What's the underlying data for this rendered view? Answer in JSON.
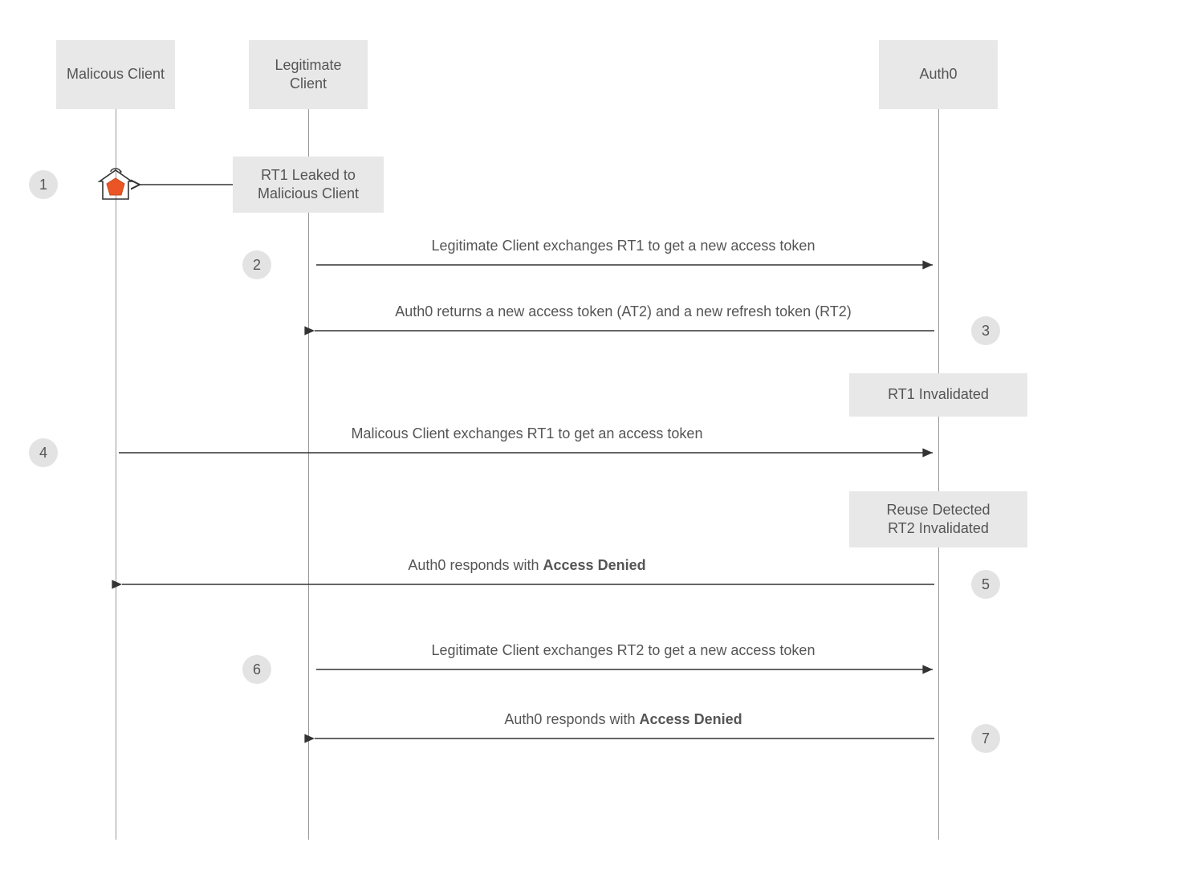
{
  "participants": {
    "malicious": "Malicous Client",
    "legitimate": "Legitimate Client",
    "auth0": "Auth0"
  },
  "notes": {
    "leak": "RT1 Leaked to Malicious Client",
    "rt1_invalidated": "RT1 Invalidated",
    "reuse_line1": "Reuse Detected",
    "reuse_line2": "RT2 Invalidated"
  },
  "messages": {
    "m2": "Legitimate Client exchanges RT1 to get a new access token",
    "m3": "Auth0 returns a new access token (AT2) and a new refresh token (RT2)",
    "m4": "Malicous Client exchanges RT1 to get an access token",
    "m5_pre": "Auth0 responds with ",
    "m5_bold": "Access Denied",
    "m6": "Legitimate Client exchanges RT2 to get a new access token",
    "m7_pre": "Auth0 responds with ",
    "m7_bold": "Access Denied"
  },
  "steps": {
    "s1": "1",
    "s2": "2",
    "s3": "3",
    "s4": "4",
    "s5": "5",
    "s6": "6",
    "s7": "7"
  }
}
